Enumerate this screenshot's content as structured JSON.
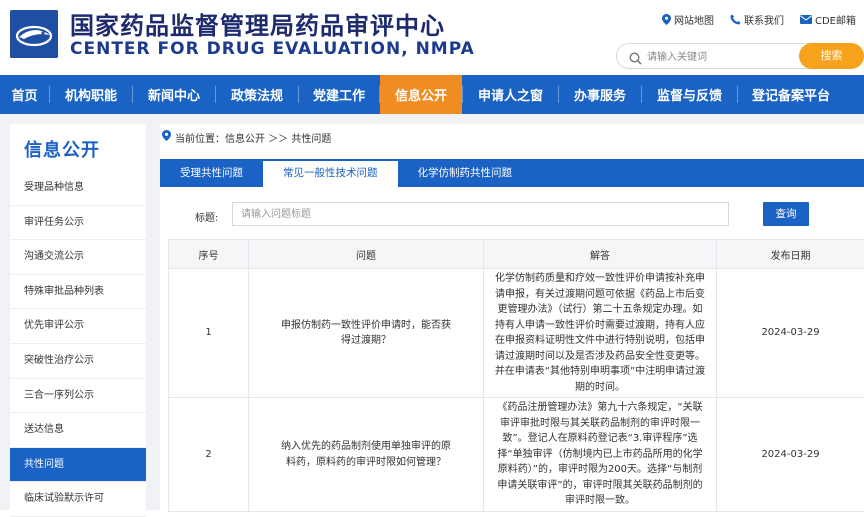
{
  "header": {
    "title_cn": "国家药品监督管理局药品审评中心",
    "title_en": "CENTER FOR DRUG EVALUATION, NMPA",
    "links": [
      {
        "label": "网站地图",
        "icon": "location-pin-icon"
      },
      {
        "label": "联系我们",
        "icon": "phone-icon"
      },
      {
        "label": "CDE邮箱",
        "icon": "mail-icon"
      }
    ],
    "search": {
      "placeholder": "请输入关键词",
      "button": "搜索"
    }
  },
  "nav": {
    "items": [
      "首页",
      "机构职能",
      "新闻中心",
      "政策法规",
      "党建工作",
      "信息公开",
      "申请人之窗",
      "办事服务",
      "监督与反馈",
      "登记备案平台"
    ],
    "active_index": 5
  },
  "sidebar": {
    "title": "信息公开",
    "items": [
      "受理品种信息",
      "审评任务公示",
      "沟通交流公示",
      "特殊审批品种列表",
      "优先审评公示",
      "突破性治疗公示",
      "三合一序列公示",
      "送达信息",
      "共性问题",
      "临床试验默示许可"
    ],
    "active_index": 8
  },
  "breadcrumb": {
    "label": "当前位置：信息公开 ＞＞ 共性问题"
  },
  "tabs": {
    "items": [
      "受理共性问题",
      "常见一般性技术问题",
      "化学仿制药共性问题"
    ],
    "active_index": 1
  },
  "filter": {
    "label": "标题:",
    "placeholder": "请输入问题标题",
    "button": "查询"
  },
  "table": {
    "headers": [
      "序号",
      "问题",
      "解答",
      "发布日期"
    ],
    "rows": [
      {
        "no": "1",
        "question": "申报仿制药一致性评价申请时，能否获得过渡期？",
        "answer": "化学仿制药质量和疗效一致性评价申请按补充申请申报，有关过渡期问题可依据《药品上市后变更管理办法》（试行）第二十五条规定办理。如持有人申请一致性评价时需要过渡期，持有人应在申报资料证明性文件中进行特别说明，包括申请过渡期时间以及是否涉及药品安全性变更等。并在申请表“其他特别申明事项”中注明申请过渡期的时间。",
        "date": "2024-03-29"
      },
      {
        "no": "2",
        "question": "纳入优先的药品制剂使用单独审评的原料药，原料药的审评时限如何管理？",
        "answer": "《药品注册管理办法》第九十六条规定，“关联审评审批时限与其关联药品制剂的审评时限一致”。登记人在原料药登记表“3.审评程序”选择“单独审评（仿制境内已上市药品所用的化学原料药）”的，审评时限为200天。选择“与制剂申请关联审评”的，审评时限其关联药品制剂的审评时限一致。",
        "date": "2024-03-29"
      }
    ]
  },
  "colors": {
    "primary": "#1a62c4",
    "accent": "#ef8c22",
    "search_button": "#f7a21b"
  }
}
